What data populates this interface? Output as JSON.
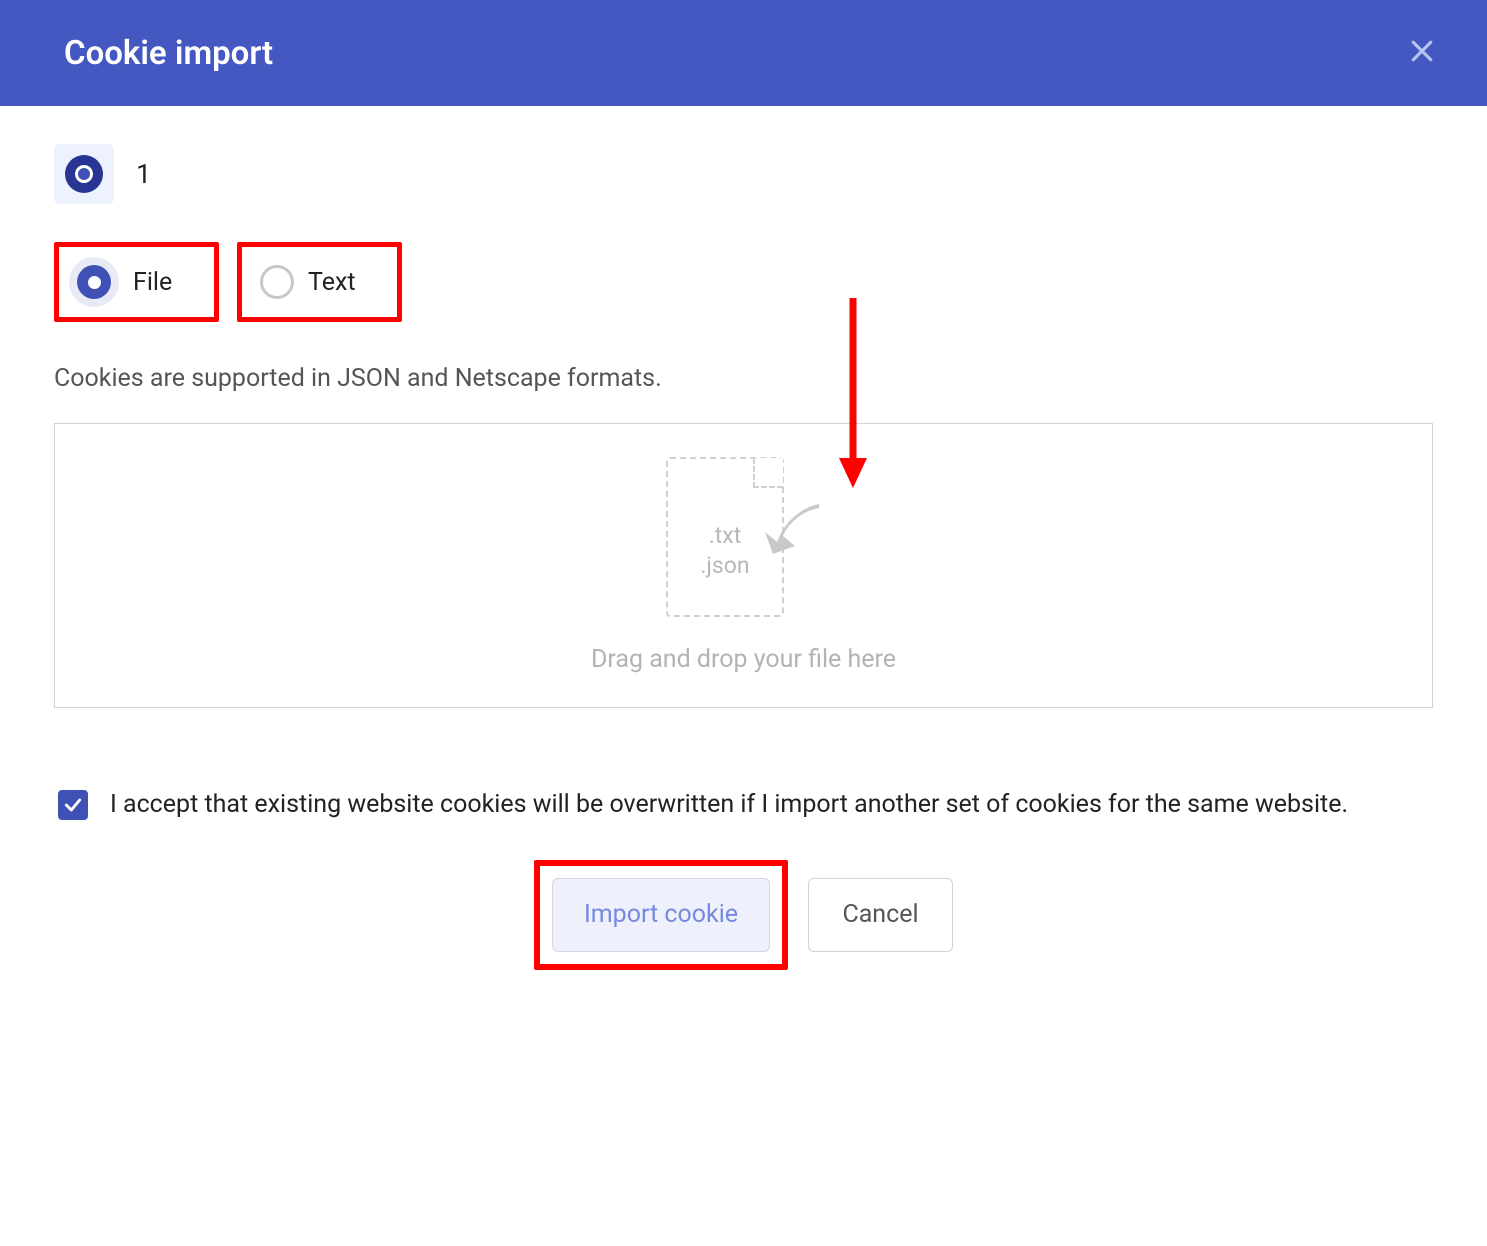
{
  "header": {
    "title": "Cookie import"
  },
  "browser": {
    "count": "1"
  },
  "modes": {
    "file": {
      "label": "File",
      "selected": true
    },
    "text": {
      "label": "Text",
      "selected": false
    }
  },
  "helper_text": "Cookies are supported in JSON and Netscape formats.",
  "dropzone": {
    "ext1": ".txt",
    "ext2": ".json",
    "hint": "Drag and drop your file here"
  },
  "consent": {
    "checked": true,
    "text": "I accept that existing website cookies will be overwritten if I import another set of cookies for the same website."
  },
  "buttons": {
    "import": "Import cookie",
    "cancel": "Cancel"
  }
}
